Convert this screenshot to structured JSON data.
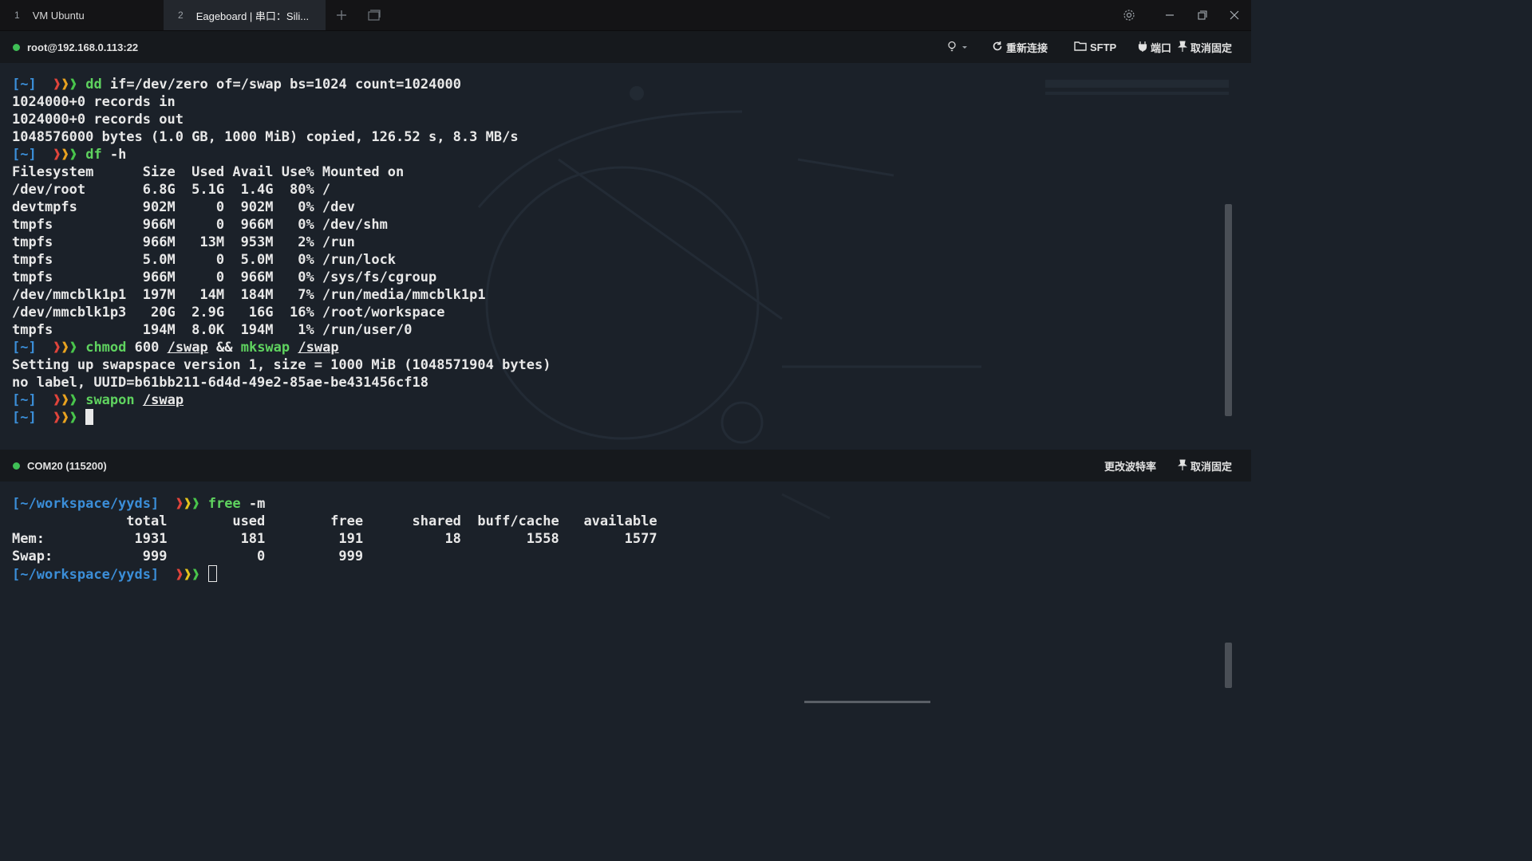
{
  "tabs": [
    {
      "num": "1",
      "label": "VM Ubuntu"
    },
    {
      "num": "2",
      "label": "Eageboard | 串口：Sili..."
    }
  ],
  "session_top": {
    "title": "root@192.168.0.113:22",
    "buttons": {
      "reconnect": "重新连接",
      "sftp": "SFTP",
      "port": "端口",
      "unpin": "取消固定"
    },
    "lines": [
      [
        {
          "t": "[~]",
          "c": "p-dir"
        },
        {
          "t": "  ",
          "c": ""
        },
        {
          "t": "❱",
          "c": "p-a1"
        },
        {
          "t": "❱",
          "c": "p-a2"
        },
        {
          "t": "❱",
          "c": "p-a3"
        },
        {
          "t": " ",
          "c": ""
        },
        {
          "t": "dd",
          "c": "cmd"
        },
        {
          "t": " if=/dev/zero of=/swap bs=1024 count=1024000",
          "c": ""
        }
      ],
      [
        {
          "t": "1024000+0 records in",
          "c": ""
        }
      ],
      [
        {
          "t": "1024000+0 records out",
          "c": ""
        }
      ],
      [
        {
          "t": "1048576000 bytes (1.0 GB, 1000 MiB) copied, 126.52 s, 8.3 MB/s",
          "c": ""
        }
      ],
      [
        {
          "t": "[~]",
          "c": "p-dir"
        },
        {
          "t": "  ",
          "c": ""
        },
        {
          "t": "❱",
          "c": "p-a1"
        },
        {
          "t": "❱",
          "c": "p-a2"
        },
        {
          "t": "❱",
          "c": "p-a3"
        },
        {
          "t": " ",
          "c": ""
        },
        {
          "t": "df",
          "c": "cmd"
        },
        {
          "t": " -h",
          "c": ""
        }
      ],
      [
        {
          "t": "Filesystem      Size  Used Avail Use% Mounted on",
          "c": ""
        }
      ],
      [
        {
          "t": "/dev/root       6.8G  5.1G  1.4G  80% /",
          "c": ""
        }
      ],
      [
        {
          "t": "devtmpfs        902M     0  902M   0% /dev",
          "c": ""
        }
      ],
      [
        {
          "t": "tmpfs           966M     0  966M   0% /dev/shm",
          "c": ""
        }
      ],
      [
        {
          "t": "tmpfs           966M   13M  953M   2% /run",
          "c": ""
        }
      ],
      [
        {
          "t": "tmpfs           5.0M     0  5.0M   0% /run/lock",
          "c": ""
        }
      ],
      [
        {
          "t": "tmpfs           966M     0  966M   0% /sys/fs/cgroup",
          "c": ""
        }
      ],
      [
        {
          "t": "/dev/mmcblk1p1  197M   14M  184M   7% /run/media/mmcblk1p1",
          "c": ""
        }
      ],
      [
        {
          "t": "/dev/mmcblk1p3   20G  2.9G   16G  16% /root/workspace",
          "c": ""
        }
      ],
      [
        {
          "t": "tmpfs           194M  8.0K  194M   1% /run/user/0",
          "c": ""
        }
      ],
      [
        {
          "t": "[~]",
          "c": "p-dir"
        },
        {
          "t": "  ",
          "c": ""
        },
        {
          "t": "❱",
          "c": "p-a1"
        },
        {
          "t": "❱",
          "c": "p-a2"
        },
        {
          "t": "❱",
          "c": "p-a3"
        },
        {
          "t": " ",
          "c": ""
        },
        {
          "t": "chmod",
          "c": "cmd"
        },
        {
          "t": " 600 ",
          "c": ""
        },
        {
          "t": "/swap",
          "c": "arg-path"
        },
        {
          "t": " && ",
          "c": ""
        },
        {
          "t": "mkswap",
          "c": "cmd"
        },
        {
          "t": " ",
          "c": ""
        },
        {
          "t": "/swap",
          "c": "arg-path"
        }
      ],
      [
        {
          "t": "Setting up swapspace version 1, size = 1000 MiB (1048571904 bytes)",
          "c": ""
        }
      ],
      [
        {
          "t": "no label, UUID=b61bb211-6d4d-49e2-85ae-be431456cf18",
          "c": ""
        }
      ],
      [
        {
          "t": "[~]",
          "c": "p-dir"
        },
        {
          "t": "  ",
          "c": ""
        },
        {
          "t": "❱",
          "c": "p-a1"
        },
        {
          "t": "❱",
          "c": "p-a2"
        },
        {
          "t": "❱",
          "c": "p-a3"
        },
        {
          "t": " ",
          "c": ""
        },
        {
          "t": "swapon",
          "c": "cmd"
        },
        {
          "t": " ",
          "c": ""
        },
        {
          "t": "/swap",
          "c": "arg-path"
        }
      ],
      [
        {
          "t": "[~]",
          "c": "p-dir"
        },
        {
          "t": "  ",
          "c": ""
        },
        {
          "t": "❱",
          "c": "p-a1"
        },
        {
          "t": "❱",
          "c": "p-a2"
        },
        {
          "t": "❱",
          "c": "p-a3"
        },
        {
          "t": " ",
          "c": ""
        },
        {
          "t": "",
          "c": "cursor-block"
        }
      ]
    ]
  },
  "session_bottom": {
    "title": "COM20 (115200)",
    "buttons": {
      "baud": "更改波特率",
      "unpin": "取消固定"
    },
    "lines": [
      [
        {
          "t": "[~/workspace/yyds]",
          "c": "p-dir"
        },
        {
          "t": "  ",
          "c": ""
        },
        {
          "t": "❱",
          "c": "p-a1"
        },
        {
          "t": "❱",
          "c": "p-a2y"
        },
        {
          "t": "❱",
          "c": "p-a3"
        },
        {
          "t": " ",
          "c": ""
        },
        {
          "t": "free",
          "c": "cmd"
        },
        {
          "t": " -m",
          "c": ""
        }
      ],
      [
        {
          "t": "              total        used        free      shared  buff/cache   available",
          "c": ""
        }
      ],
      [
        {
          "t": "Mem:           1931         181         191          18        1558        1577",
          "c": ""
        }
      ],
      [
        {
          "t": "Swap:           999           0         999",
          "c": ""
        }
      ],
      [
        {
          "t": "[~/workspace/yyds]",
          "c": "p-dir"
        },
        {
          "t": "  ",
          "c": ""
        },
        {
          "t": "❱",
          "c": "p-a1"
        },
        {
          "t": "❱",
          "c": "p-a2y"
        },
        {
          "t": "❱",
          "c": "p-a3"
        },
        {
          "t": " ",
          "c": ""
        },
        {
          "t": "",
          "c": "cursor-hollow"
        }
      ]
    ]
  },
  "colors": {
    "background": "#1b2129",
    "header": "#16191d",
    "tabbar": "#141416",
    "prompt_dir": "#3b8ed8",
    "command": "#5fd35f",
    "status_online": "#3fbf56"
  },
  "icons": [
    "add-tab-icon",
    "window-icon",
    "settings-icon",
    "minimize-icon",
    "restore-icon",
    "close-icon",
    "lightbulb-icon",
    "reconnect-icon",
    "folder-icon",
    "plug-icon",
    "pin-icon"
  ]
}
